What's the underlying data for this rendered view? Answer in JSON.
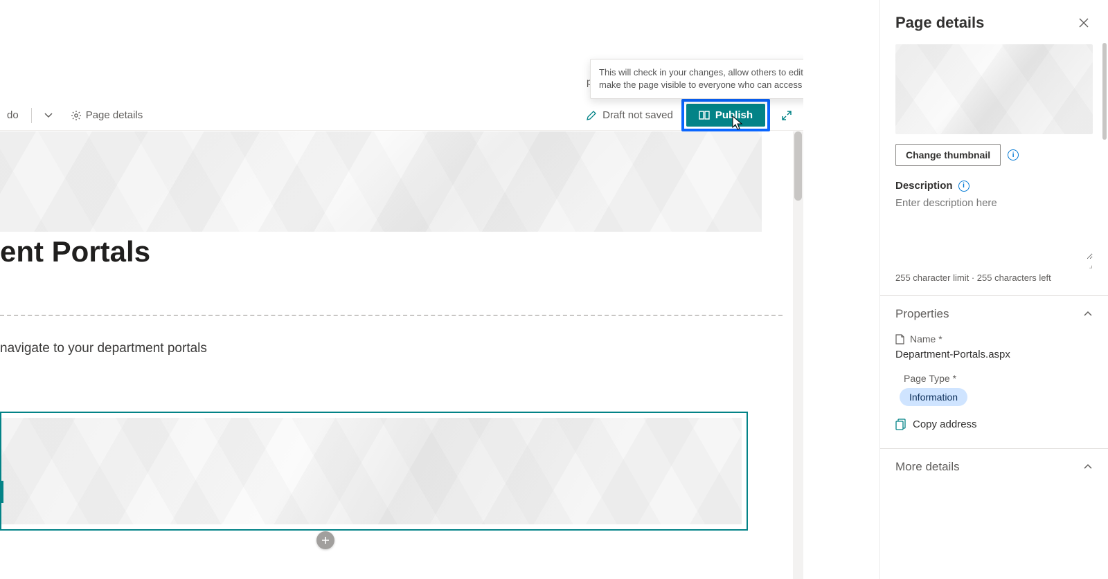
{
  "toolbar": {
    "undo_text": "do",
    "page_details_label": "Page details",
    "draft_status": "Draft not saved",
    "publish_label": "Publish"
  },
  "tooltip": {
    "text": "This will check in your changes, allow others to edit, and make the page visible to everyone who can access this site.",
    "trailing_p": "p"
  },
  "page": {
    "title": "ent Portals",
    "subtitle": "navigate to your department portals"
  },
  "panel": {
    "title": "Page details",
    "change_thumbnail": "Change thumbnail",
    "description_label": "Description",
    "description_placeholder": "Enter description here",
    "char_limit_text": "255 character limit · 255 characters left",
    "properties_label": "Properties",
    "name_label": "Name *",
    "name_value": "Department-Portals.aspx",
    "page_type_label": "Page Type *",
    "page_type_value": "Information",
    "copy_address": "Copy address",
    "more_details": "More details"
  }
}
